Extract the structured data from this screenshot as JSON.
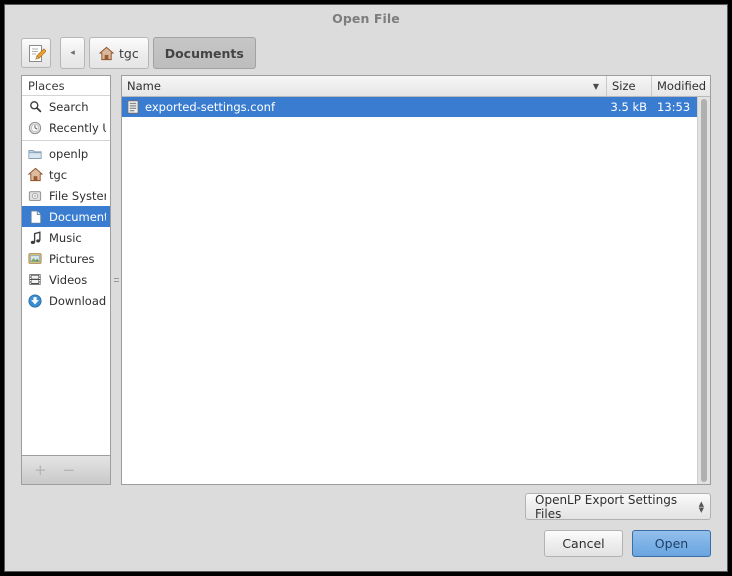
{
  "window": {
    "title": "Open File"
  },
  "toolbar": {
    "location_button_name": "type-a-file-name",
    "back_label": "◂",
    "path_buttons": [
      {
        "label": "tgc",
        "icon": "home-icon",
        "active": false
      },
      {
        "label": "Documents",
        "icon": "",
        "active": true
      }
    ]
  },
  "sidebar": {
    "header": "Places",
    "items": [
      {
        "label": "Search",
        "icon": "search-icon",
        "selected": false
      },
      {
        "label": "Recently U...",
        "icon": "recent-icon",
        "selected": false
      },
      {
        "label": "openlp",
        "icon": "folder-icon",
        "selected": false
      },
      {
        "label": "tgc",
        "icon": "home-icon",
        "selected": false
      },
      {
        "label": "File System",
        "icon": "drive-icon",
        "selected": false
      },
      {
        "label": "Documents",
        "icon": "document-icon",
        "selected": true
      },
      {
        "label": "Music",
        "icon": "music-note-icon",
        "selected": false
      },
      {
        "label": "Pictures",
        "icon": "pictures-icon",
        "selected": false
      },
      {
        "label": "Videos",
        "icon": "film-icon",
        "selected": false
      },
      {
        "label": "Downloads",
        "icon": "download-icon",
        "selected": false
      }
    ],
    "footer": {
      "add_label": "+",
      "remove_label": "−"
    }
  },
  "file_list": {
    "columns": {
      "name": "Name",
      "size": "Size",
      "modified": "Modified"
    },
    "sort_indicator": "▼",
    "rows": [
      {
        "name": "exported-settings.conf",
        "size": "3.5 kB",
        "modified": "13:53",
        "icon": "text-file-icon",
        "selected": true
      }
    ]
  },
  "footer": {
    "filter_value": "OpenLP Export Settings Files",
    "spinner_up": "▲",
    "spinner_down": "▼",
    "cancel_label": "Cancel",
    "open_label": "Open"
  },
  "colors": {
    "selection_blue": "#3a7dd0",
    "dialog_bg": "#dcdcdc",
    "open_button_blue": "#7cb1e6"
  }
}
